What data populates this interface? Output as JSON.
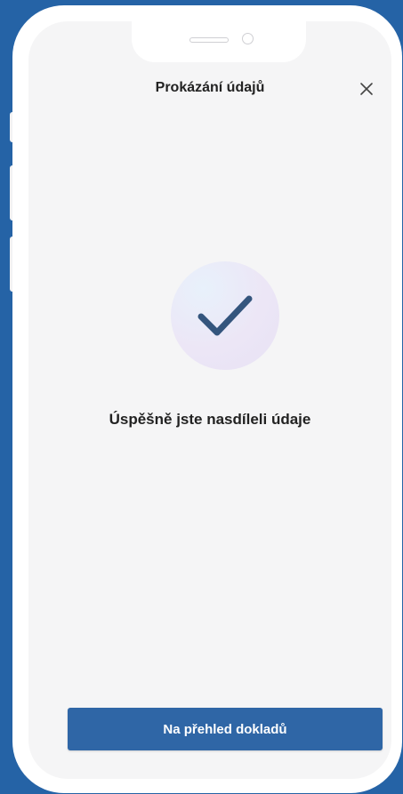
{
  "header": {
    "title": "Prokázání údajů"
  },
  "icons": {
    "close": "close-icon",
    "success": "checkmark-icon"
  },
  "content": {
    "success_message": "Úspěšně jste nasdíleli údaje"
  },
  "footer": {
    "primary_button_label": "Na přehled dokladů"
  },
  "colors": {
    "background": "#2563a6",
    "screen": "#f5f5f6",
    "primary": "#2f66a6",
    "checkmark": "#34557d",
    "text": "#222222"
  }
}
